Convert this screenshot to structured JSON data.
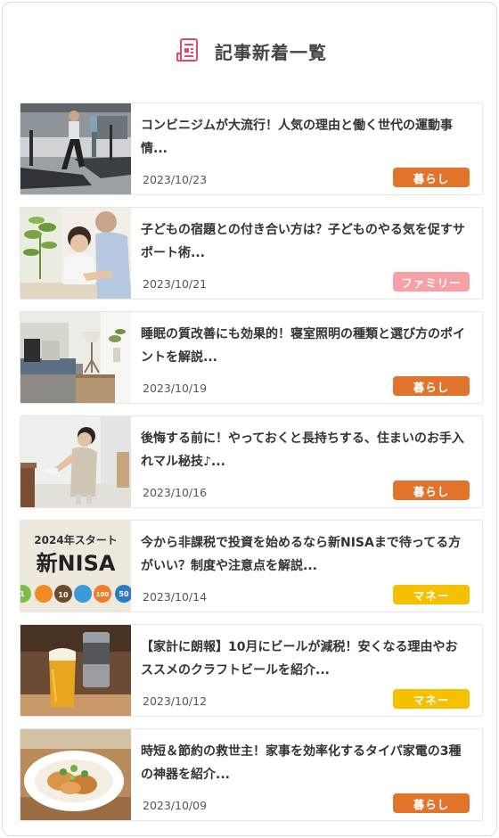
{
  "section": {
    "title": "記事新着一覧",
    "icon": "document-icon",
    "accent_color": "#e3476b"
  },
  "categories": {
    "kurashi": {
      "label": "暮らし",
      "color": "#e0742d"
    },
    "family": {
      "label": "ファミリー",
      "color": "#f7a0a6"
    },
    "money": {
      "label": "マネー",
      "color": "#f5c000"
    }
  },
  "articles": [
    {
      "title": "コンビニジムが大流行！人気の理由と働く世代の運動事情...",
      "date": "2023/10/23",
      "category": "暮らし"
    },
    {
      "title": "子どもの宿題との付き合い方は？子どものやる気を促すサポート術...",
      "date": "2023/10/21",
      "category": "ファミリー"
    },
    {
      "title": "睡眠の質改善にも効果的！寝室照明の種類と選び方のポイントを解説...",
      "date": "2023/10/19",
      "category": "暮らし"
    },
    {
      "title": "後悔する前に！やっておくと長持ちする、住まいのお手入れマル秘技♪...",
      "date": "2023/10/16",
      "category": "暮らし"
    },
    {
      "title": "今から非課税で投資を始めるなら新NISAまで待ってる方がいい？制度や注意点を解説...",
      "date": "2023/10/14",
      "category": "マネー"
    },
    {
      "title": "【家計に朗報】10月にビールが減税！安くなる理由やおススメのクラフトビールを紹介...",
      "date": "2023/10/12",
      "category": "マネー"
    },
    {
      "title": "時短＆節約の救世主！家事を効率化するタイパ家電の3種の神器を紹介...",
      "date": "2023/10/09",
      "category": "暮らし"
    }
  ],
  "thumbnails": {
    "nisa_heading": "2024年スタート",
    "nisa_title": "新NISA",
    "nisa_coins": [
      "1",
      "10",
      "100",
      "50"
    ]
  }
}
